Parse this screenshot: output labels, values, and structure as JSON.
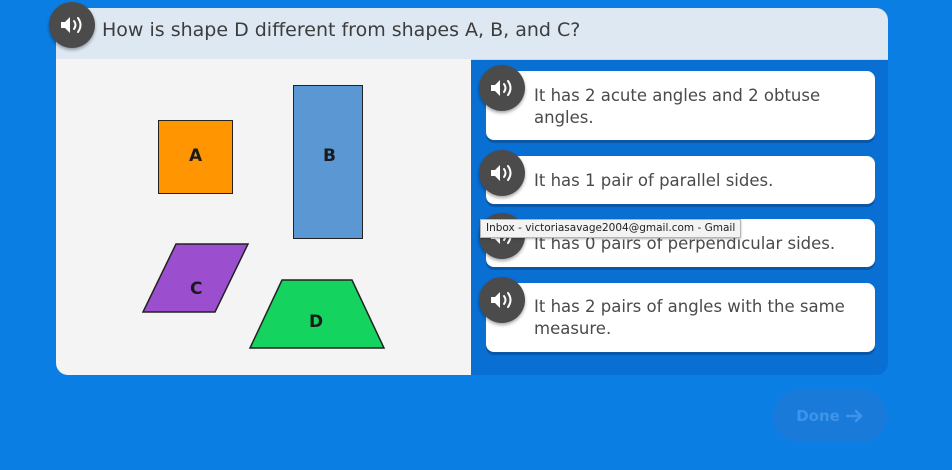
{
  "question": {
    "text": "How is shape D different from shapes A, B, and C?",
    "audio_icon": "speaker-icon"
  },
  "shapes": [
    {
      "label": "A",
      "color": "#ff9500",
      "kind": "square"
    },
    {
      "label": "B",
      "color": "#5b97d3",
      "kind": "rectangle"
    },
    {
      "label": "C",
      "color": "#9b4fcf",
      "kind": "parallelogram"
    },
    {
      "label": "D",
      "color": "#15d35f",
      "kind": "trapezoid"
    }
  ],
  "answers": [
    {
      "text": "It has 2 acute angles and 2 obtuse angles."
    },
    {
      "text": "It has 1 pair of parallel sides."
    },
    {
      "text": "It has 0 pairs of perpendicular sides."
    },
    {
      "text": "It has 2 pairs of angles with the same measure."
    }
  ],
  "tooltip": {
    "text": "Inbox - victoriasavage2004@gmail.com - Gmail"
  },
  "done_button": {
    "label": "Done",
    "icon": "arrow-right-icon"
  },
  "colors": {
    "background": "#0b7ee3",
    "card": "#0a6fd2",
    "question_bar": "#dde8f2",
    "speaker": "#4b4b4b"
  }
}
